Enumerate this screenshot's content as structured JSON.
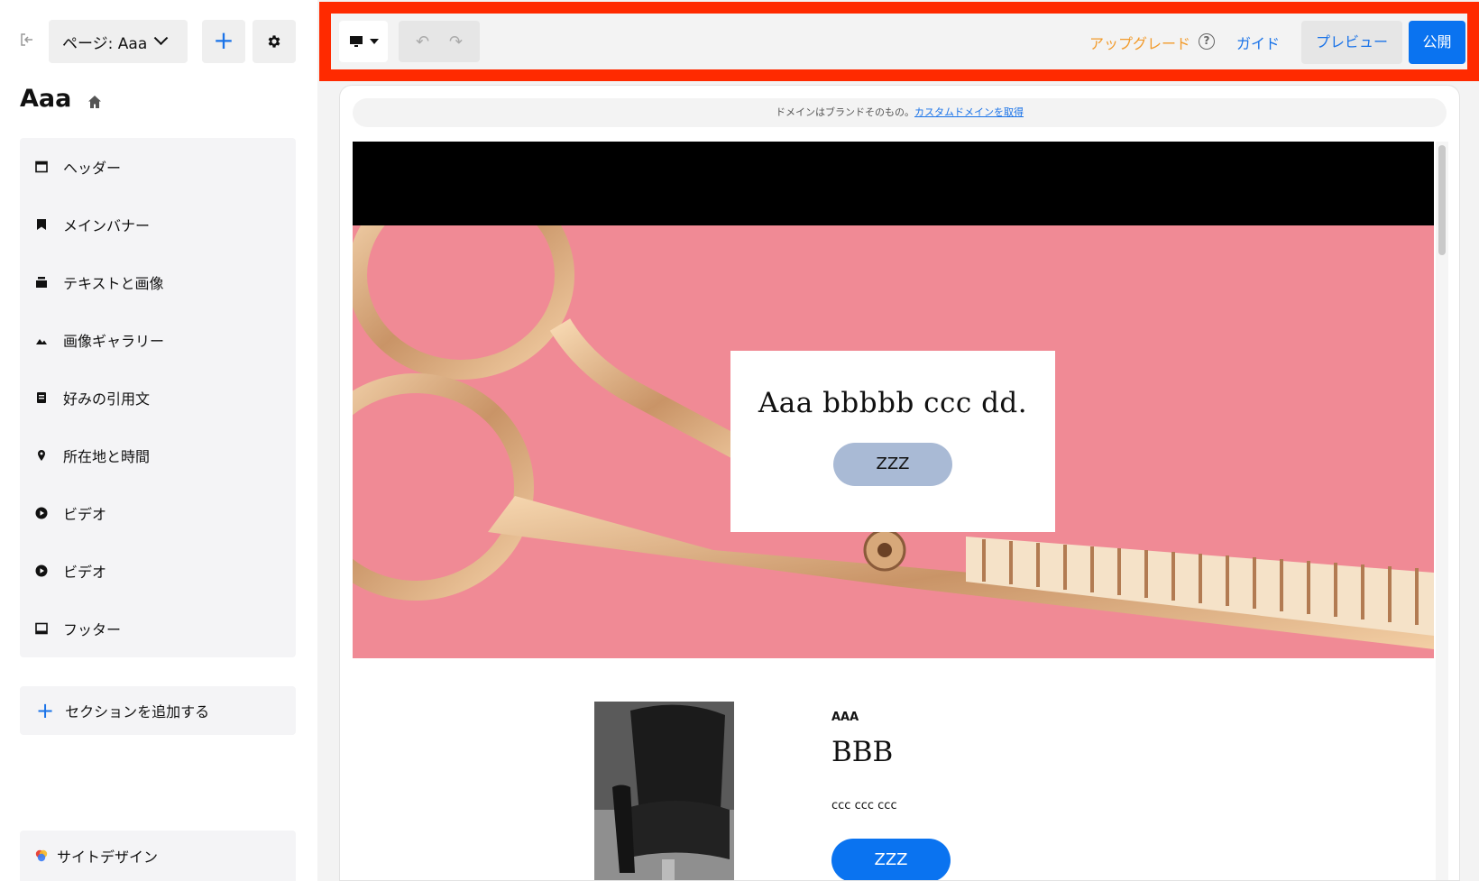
{
  "sidebar": {
    "page_select_label": "ページ: Aaa",
    "site_title": "Aaa",
    "sections": [
      {
        "label": "ヘッダー",
        "icon": "header-icon"
      },
      {
        "label": "メインバナー",
        "icon": "bookmark-icon"
      },
      {
        "label": "テキストと画像",
        "icon": "text-image-icon"
      },
      {
        "label": "画像ギャラリー",
        "icon": "mountain-icon"
      },
      {
        "label": "好みの引用文",
        "icon": "quote-icon"
      },
      {
        "label": "所在地と時間",
        "icon": "location-pin-icon"
      },
      {
        "label": "ビデオ",
        "icon": "play-icon"
      },
      {
        "label": "ビデオ",
        "icon": "play-icon"
      },
      {
        "label": "フッター",
        "icon": "footer-icon"
      }
    ],
    "add_section_label": "セクションを追加する",
    "site_design_label": "サイトデザイン"
  },
  "toolbar": {
    "upgrade_label": "アップグレード",
    "guide_label": "ガイド",
    "preview_label": "プレビュー",
    "publish_label": "公開",
    "accent_color": "#0a73f0",
    "upgrade_color": "#f29b2c",
    "highlight_color": "#ff2a00"
  },
  "canvas": {
    "domain_notice": "ドメインはブランドそのもの。",
    "domain_link": "カスタムドメインを取得",
    "banner": {
      "headline": "Aaa bbbbb ccc dd.",
      "button_label": "ZZZ"
    },
    "text_image": {
      "eyebrow": "AAA",
      "title": "BBB",
      "body": "ccc ccc ccc",
      "button_label": "ZZZ"
    }
  }
}
